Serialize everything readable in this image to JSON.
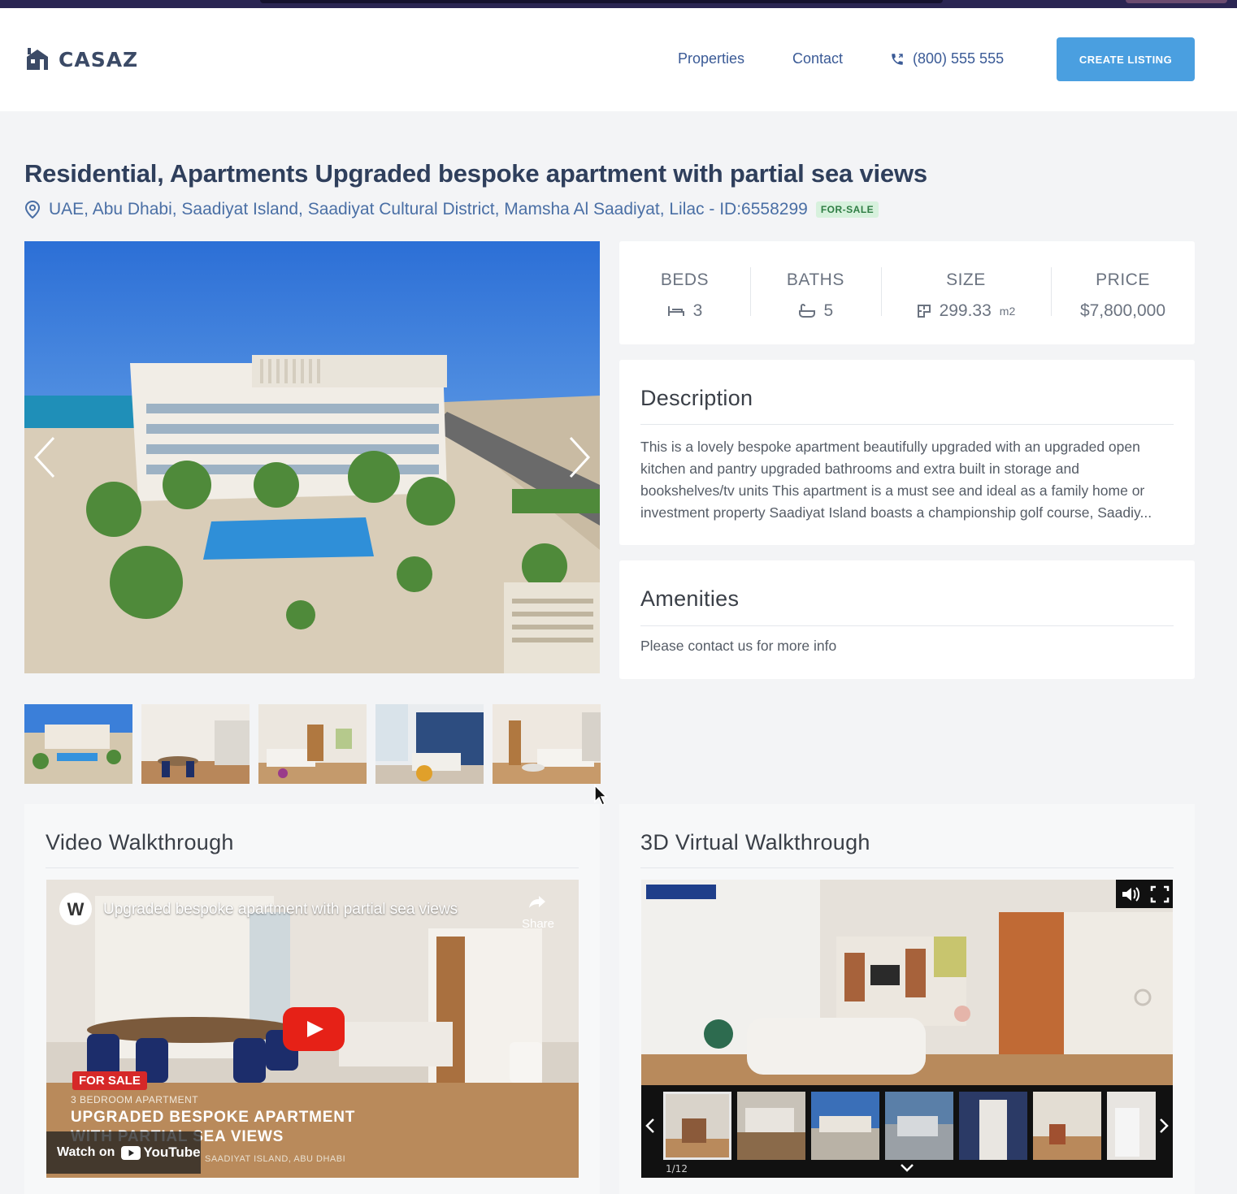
{
  "header": {
    "brand": "CASAZ",
    "nav": [
      "Properties",
      "Contact"
    ],
    "phone": "(800) 555 555",
    "cta_label": "CREATE LISTING"
  },
  "listing": {
    "title": "Residential, Apartments Upgraded bespoke apartment with partial sea views",
    "address": "UAE, Abu Dhabi, Saadiyat Island, Saadiyat Cultural District, Mamsha Al Saadiyat, Lilac - ID:6558299",
    "status_badge": "FOR-SALE"
  },
  "stats": {
    "beds_label": "BEDS",
    "beds": "3",
    "baths_label": "BATHS",
    "baths": "5",
    "size_label": "SIZE",
    "size": "299.33",
    "size_unit": "m2",
    "price_label": "PRICE",
    "price": "$7,800,000"
  },
  "description": {
    "title": "Description",
    "text": "This is a lovely bespoke apartment beautifully upgraded with an upgraded open kitchen and pantry upgraded bathrooms and extra built in storage and bookshelves/tv units This apartment is a must see and ideal as a family home or investment property Saadiyat Island boasts a championship golf course, Saadiy..."
  },
  "amenities": {
    "title": "Amenities",
    "text": "Please contact us for more info"
  },
  "video": {
    "section_title": "Video Walkthrough",
    "embed_title": "Upgraded bespoke apartment with partial sea views",
    "share_label": "Share",
    "overlay_badge": "FOR SALE",
    "overlay_subtitle": "3 BEDROOM APARTMENT",
    "overlay_heading_1": "UPGRADED BESPOKE APARTMENT",
    "overlay_heading_2": "WITH PARTIAL SEA VIEWS",
    "overlay_location": "SAADIYAT ISLAND, ABU DHABI",
    "watch_on": "Watch on",
    "youtube": "YouTube"
  },
  "tour": {
    "section_title": "3D Virtual Walkthrough",
    "counter": "1/12"
  },
  "colors": {
    "brand_blue": "#4a9fe0",
    "nav_link": "#3a5a96",
    "badge_bg": "#d7f1dd",
    "badge_text": "#2f7d44",
    "youtube_red": "#e62117"
  },
  "icons": [
    "logo-house-icon",
    "phone-icon",
    "location-pin-icon",
    "bed-icon",
    "bath-icon",
    "floorplan-icon",
    "chevron-left-icon",
    "chevron-right-icon",
    "play-icon",
    "share-icon",
    "volume-icon",
    "fullscreen-icon",
    "chevron-down-icon",
    "mouse-cursor-icon"
  ]
}
